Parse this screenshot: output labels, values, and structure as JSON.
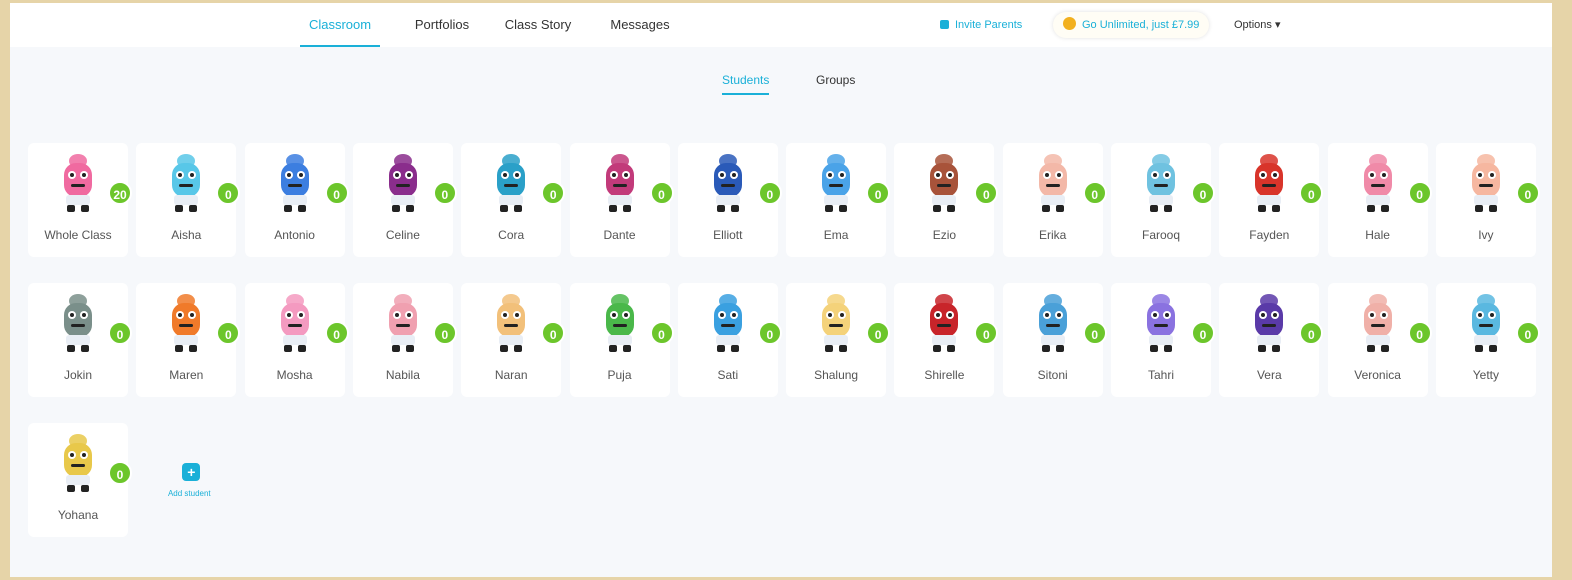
{
  "nav": {
    "tabs": [
      "Classroom",
      "Portfolios",
      "Class Story",
      "Messages"
    ],
    "active_index": 0,
    "accent": "#1ab0d8"
  },
  "header_right": {
    "report_link": "Invite Parents",
    "points_pill": "Go Unlimited, just £7.99",
    "options": "Options ▾"
  },
  "subtabs": {
    "students": "Students",
    "groups": "Groups"
  },
  "students": [
    {
      "name": "Whole Class",
      "points": "20",
      "color": "#f06aa0"
    },
    {
      "name": "Aisha",
      "points": "0",
      "color": "#58c7e8"
    },
    {
      "name": "Antonio",
      "points": "0",
      "color": "#3c7ee0"
    },
    {
      "name": "Celine",
      "points": "0",
      "color": "#8a2d8c"
    },
    {
      "name": "Cora",
      "points": "0",
      "color": "#2aa0c8"
    },
    {
      "name": "Dante",
      "points": "0",
      "color": "#c23a7a"
    },
    {
      "name": "Elliott",
      "points": "0",
      "color": "#2a5ab8"
    },
    {
      "name": "Ema",
      "points": "0",
      "color": "#4aa3e8"
    },
    {
      "name": "Ezio",
      "points": "0",
      "color": "#a8533a"
    },
    {
      "name": "Erika",
      "points": "0",
      "color": "#f3b8a8"
    },
    {
      "name": "Farooq",
      "points": "0",
      "color": "#6fc2e0"
    },
    {
      "name": "Fayden",
      "points": "0",
      "color": "#d8342a"
    },
    {
      "name": "Hale",
      "points": "0",
      "color": "#f08aa8"
    },
    {
      "name": "Ivy",
      "points": "0",
      "color": "#f6b7a0"
    },
    {
      "name": "Jokin",
      "points": "0",
      "color": "#7a8f8a"
    },
    {
      "name": "Maren",
      "points": "0",
      "color": "#f07a2a"
    },
    {
      "name": "Mosha",
      "points": "0",
      "color": "#f49ac0"
    },
    {
      "name": "Nabila",
      "points": "0",
      "color": "#f0a0b0"
    },
    {
      "name": "Naran",
      "points": "0",
      "color": "#f2c07a"
    },
    {
      "name": "Puja",
      "points": "0",
      "color": "#4ab84a"
    },
    {
      "name": "Sati",
      "points": "0",
      "color": "#3aa0e0"
    },
    {
      "name": "Shalung",
      "points": "0",
      "color": "#f4d27a"
    },
    {
      "name": "Shirelle",
      "points": "0",
      "color": "#c8242a"
    },
    {
      "name": "Sitoni",
      "points": "0",
      "color": "#4aa0d8"
    },
    {
      "name": "Tahri",
      "points": "0",
      "color": "#8a72e0"
    },
    {
      "name": "Vera",
      "points": "0",
      "color": "#5a3aa8"
    },
    {
      "name": "Veronica",
      "points": "0",
      "color": "#f0b0a8"
    },
    {
      "name": "Yetty",
      "points": "0",
      "color": "#5ab8e0"
    },
    {
      "name": "Yohana",
      "points": "0",
      "color": "#e8c84a"
    }
  ],
  "add_student": {
    "label": "Add student",
    "icon": "plus-icon"
  }
}
